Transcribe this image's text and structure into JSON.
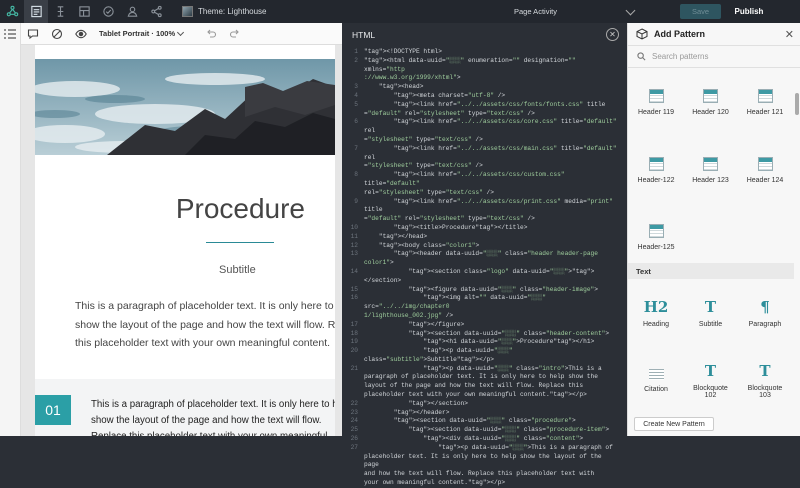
{
  "topbar": {
    "icons": [
      "logo-icon",
      "pages-icon",
      "outline-icon",
      "layout-icon",
      "check-icon",
      "users-icon",
      "share-icon"
    ],
    "theme_label": "Theme: Lighthouse",
    "activity_label": "Page Activity",
    "save_label": "Save",
    "publish_label": "Publish"
  },
  "preview": {
    "device_label": "Tablet Portrait · 100%",
    "title": "Procedure",
    "subtitle": "Subtitle",
    "intro": "This is a paragraph of placeholder text. It is only here to help show the layout of the page and how the text will flow. Replace this placeholder text with your own meaningful content.",
    "step_number": "01",
    "step_text": "This is a paragraph of placeholder text. It is only here to help show the layout of the page and how the text will flow. Replace this placeholder text with your own meaningful content."
  },
  "code": {
    "title": "HTML",
    "lines": [
      {
        "n": "1",
        "t": "<!DOCTYPE html>"
      },
      {
        "n": "2",
        "t": "<html data-uuid=\"░░░\" enumeration=\"\" designation=\"\" xmlns=\"http\n://www.w3.org/1999/xhtml\">"
      },
      {
        "n": "3",
        "t": "    <head>"
      },
      {
        "n": "4",
        "t": "        <meta charset=\"utf-8\" />"
      },
      {
        "n": "5",
        "t": "        <link href=\"../../assets/css/fonts/fonts.css\" title\n=\"default\" rel=\"stylesheet\" type=\"text/css\" />"
      },
      {
        "n": "6",
        "t": "        <link href=\"../../assets/css/core.css\" title=\"default\" rel\n=\"stylesheet\" type=\"text/css\" />"
      },
      {
        "n": "7",
        "t": "        <link href=\"../../assets/css/main.css\" title=\"default\" rel\n=\"stylesheet\" type=\"text/css\" />"
      },
      {
        "n": "8",
        "t": "        <link href=\"../../assets/css/custom.css\" title=\"default\"\nrel=\"stylesheet\" type=\"text/css\" />"
      },
      {
        "n": "9",
        "t": "        <link href=\"../../assets/css/print.css\" media=\"print\" title\n=\"default\" rel=\"stylesheet\" type=\"text/css\" />"
      },
      {
        "n": "10",
        "t": "        <title>Procedure</title>"
      },
      {
        "n": "11",
        "t": "    </head>"
      },
      {
        "n": "12",
        "t": "    <body class=\"color1\">"
      },
      {
        "n": "13",
        "t": "        <header data-uuid=\"░░░\" class=\"header header-page color1\">"
      },
      {
        "n": "14",
        "t": "            <section class=\"logo\" data-uuid=\"░░░\"></section>"
      },
      {
        "n": "15",
        "t": "            <figure data-uuid=\"░░░\" class=\"header-image\">"
      },
      {
        "n": "16",
        "t": "                <img alt=\"\" data-uuid=\"░░░\" src=\"../../img/chapter0\n1/lighthouse_002.jpg\" />"
      },
      {
        "n": "17",
        "t": "            </figure>"
      },
      {
        "n": "18",
        "t": "            <section data-uuid=\"░░░\" class=\"header-content\">"
      },
      {
        "n": "19",
        "t": "                <h1 data-uuid=\"░░░\">Procedure</h1>"
      },
      {
        "n": "20",
        "t": "                <p data-uuid=\"░░░\" class=\"subtitle\">Subtitle</p>"
      },
      {
        "n": "21",
        "t": "                <p data-uuid=\"░░░\" class=\"intro\">This is a\nparagraph of placeholder text. It is only here to help show the\nlayout of the page and how the text will flow. Replace this\nplaceholder text with your own meaningful content.</p>"
      },
      {
        "n": "22",
        "t": "            </section>"
      },
      {
        "n": "23",
        "t": "        </header>"
      },
      {
        "n": "24",
        "t": "        <section data-uuid=\"░░░\" class=\"procedure\">"
      },
      {
        "n": "25",
        "t": "            <section data-uuid=\"░░░\" class=\"procedure-item\">"
      },
      {
        "n": "26",
        "t": "                <div data-uuid=\"░░░\" class=\"content\">"
      },
      {
        "n": "27",
        "t": "                    <p data-uuid=\"░░░\">This is a paragraph of\nplaceholder text. It is only here to help show the layout of the page\nand how the text will flow. Replace this placeholder text with\nyour own meaningful content.</p>"
      }
    ]
  },
  "patterns": {
    "title": "Add Pattern",
    "search_placeholder": "Search patterns",
    "headers": [
      "Header 119",
      "Header 120",
      "Header 121",
      "Header-122",
      "Header 123",
      "Header 124",
      "Header-125"
    ],
    "text_section_label": "Text",
    "text_items": [
      {
        "label": "Heading",
        "glyph": "H2"
      },
      {
        "label": "Subtitle",
        "glyph": "T"
      },
      {
        "label": "Paragraph",
        "glyph": "¶"
      },
      {
        "label": "Citation",
        "glyph": ""
      },
      {
        "label": "Blockquote 102",
        "glyph": "T"
      },
      {
        "label": "Blockquote 103",
        "glyph": "T"
      }
    ],
    "new_pattern_label": "Create New Pattern"
  }
}
